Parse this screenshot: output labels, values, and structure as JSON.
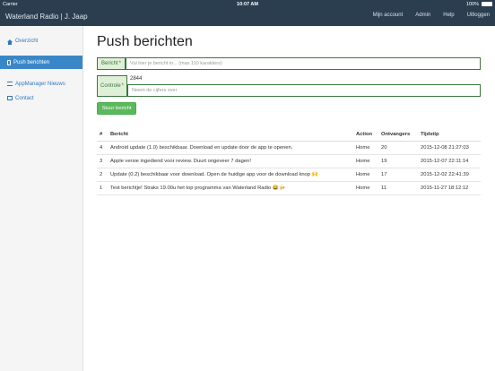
{
  "status_bar": {
    "carrier": "Carrier",
    "time": "10:07 AM",
    "battery": "100%"
  },
  "navbar": {
    "brand": "Waterland Radio | J. Jaap",
    "links": [
      "Mijn account",
      "Admin",
      "Help",
      "Uitloggen"
    ]
  },
  "sidebar": {
    "items": [
      {
        "label": "Overzicht",
        "icon": "home-icon",
        "active": false
      },
      {
        "label": "Push berichten",
        "icon": "phone-icon",
        "active": true
      },
      {
        "label": "AppManager Nieuws",
        "icon": "apps-icon",
        "active": false
      },
      {
        "label": "Contact",
        "icon": "mail-icon",
        "active": false
      }
    ]
  },
  "page": {
    "title": "Push berichten",
    "bericht_label": "Bericht",
    "bericht_required": "*",
    "bericht_placeholder": "Vul hier je bericht in... (max 110 karakters)",
    "controle_label": "Controle",
    "controle_required": "*",
    "controle_code": "2844",
    "controle_placeholder": "Neem de cijfers over",
    "submit_label": "Stuur bericht"
  },
  "table": {
    "headers": [
      "#",
      "Bericht",
      "Action",
      "Ontvangers",
      "Tijdstip"
    ],
    "rows": [
      [
        "4",
        "Android update (1.0) beschikbaar. Download en update door de app te openen.",
        "Home",
        "20",
        "2015-12-08 21:27:03"
      ],
      [
        "3",
        "Apple versie ingediend voor review. Duurt ongeveer 7 dagen!",
        "Home",
        "19",
        "2015-12-07 22:11:14"
      ],
      [
        "2",
        "Update (0.2) beschikbaar voor download. Open de huidige app voor de download knop 🙌",
        "Home",
        "17",
        "2015-12-02 22:41:39"
      ],
      [
        "1",
        "Test berichtje! Straks 19.00u het top programma van Waterland Radio 😄🍻",
        "Home",
        "11",
        "2015-11-27 18:12:12"
      ]
    ]
  }
}
